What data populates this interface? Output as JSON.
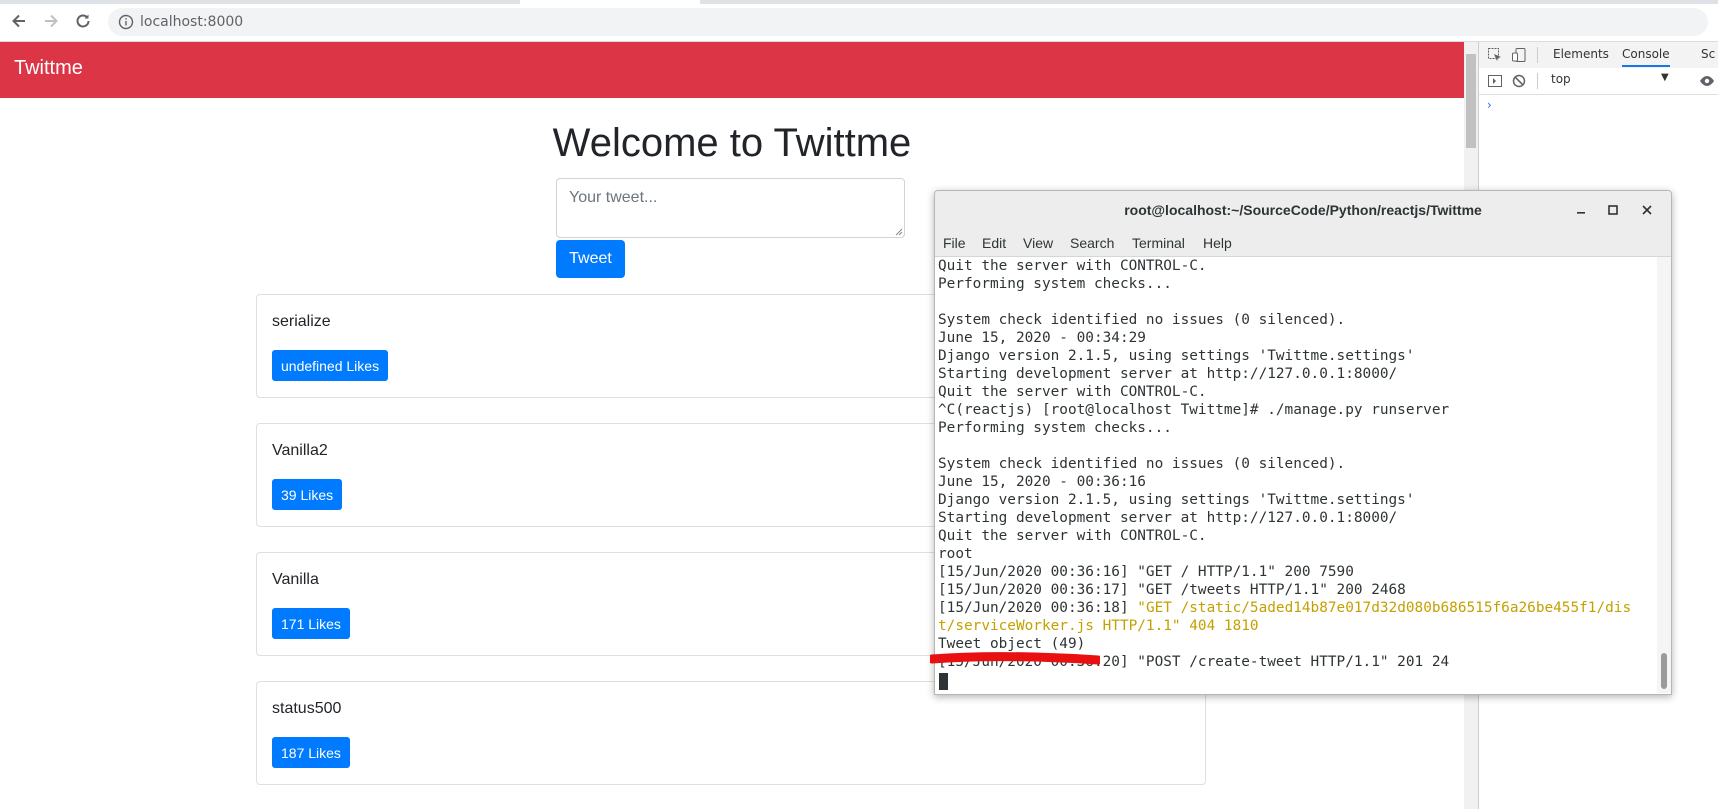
{
  "browser": {
    "url": "localhost:8000",
    "icons": [
      "back-arrow-icon",
      "forward-arrow-icon",
      "reload-icon",
      "info-icon"
    ]
  },
  "app": {
    "brand": "Twittme",
    "title": "Welcome to Twittme",
    "tweet_placeholder": "Your tweet...",
    "tweet_button": "Tweet",
    "brand_color": "#dc3545",
    "button_color": "#007bff"
  },
  "tweets": [
    {
      "content": "serialize",
      "likes_label": "undefined Likes"
    },
    {
      "content": "Vanilla2",
      "likes_label": "39 Likes"
    },
    {
      "content": "Vanilla",
      "likes_label": "171 Likes"
    },
    {
      "content": "status500",
      "likes_label": "187 Likes"
    }
  ],
  "devtools": {
    "tabs": [
      "Elements",
      "Console",
      "Sc"
    ],
    "active_tab": "Console",
    "context": "top",
    "prompt": "›"
  },
  "terminal": {
    "title": "root@localhost:~/SourceCode/Python/reactjs/Twittme",
    "menu": [
      "File",
      "Edit",
      "View",
      "Search",
      "Terminal",
      "Help"
    ],
    "lines": [
      {
        "text": "Quit the server with CONTROL-C.",
        "warn": false
      },
      {
        "text": "Performing system checks...",
        "warn": false
      },
      {
        "text": "",
        "warn": false
      },
      {
        "text": "System check identified no issues (0 silenced).",
        "warn": false
      },
      {
        "text": "June 15, 2020 - 00:34:29",
        "warn": false
      },
      {
        "text": "Django version 2.1.5, using settings 'Twittme.settings'",
        "warn": false
      },
      {
        "text": "Starting development server at http://127.0.0.1:8000/",
        "warn": false
      },
      {
        "text": "Quit the server with CONTROL-C.",
        "warn": false
      },
      {
        "text": "^C(reactjs) [root@localhost Twittme]# ./manage.py runserver",
        "warn": false
      },
      {
        "text": "Performing system checks...",
        "warn": false
      },
      {
        "text": "",
        "warn": false
      },
      {
        "text": "System check identified no issues (0 silenced).",
        "warn": false
      },
      {
        "text": "June 15, 2020 - 00:36:16",
        "warn": false
      },
      {
        "text": "Django version 2.1.5, using settings 'Twittme.settings'",
        "warn": false
      },
      {
        "text": "Starting development server at http://127.0.0.1:8000/",
        "warn": false
      },
      {
        "text": "Quit the server with CONTROL-C.",
        "warn": false
      },
      {
        "text": "root",
        "warn": false
      },
      {
        "text": "[15/Jun/2020 00:36:16] \"GET / HTTP/1.1\" 200 7590",
        "warn": false
      },
      {
        "text": "[15/Jun/2020 00:36:17] \"GET /tweets HTTP/1.1\" 200 2468",
        "warn": false
      },
      {
        "text": "[15/Jun/2020 00:36:18] ",
        "warn": false,
        "warn_tail": "\"GET /static/5aded14b87e017d32d080b686515f6a26be455f1/dis"
      },
      {
        "text": "t/serviceWorker.js HTTP/1.1\" 404 1810",
        "warn": true
      },
      {
        "text": "Tweet object (49)",
        "warn": false
      },
      {
        "text": "[15/Jun/2020 00:36:20] \"POST /create-tweet HTTP/1.1\" 201 24",
        "warn": false
      }
    ]
  }
}
